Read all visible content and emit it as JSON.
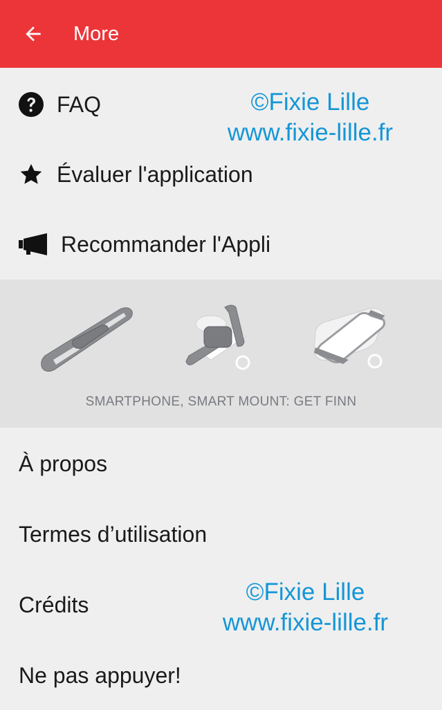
{
  "appbar": {
    "title": "More",
    "back_icon": "arrow-left-icon",
    "color": "#ec3539"
  },
  "menu_top": [
    {
      "label": "FAQ",
      "icon": "question-circle-icon"
    },
    {
      "label": "Évaluer l'application",
      "icon": "star-icon"
    },
    {
      "label": "Recommander l'Appli",
      "icon": "megaphone-icon"
    }
  ],
  "banner": {
    "caption": "SMARTPHONE, SMART MOUNT: GET FINN",
    "images": [
      "finn-strap-flat",
      "finn-strap-on-bar",
      "finn-phone-mounted"
    ]
  },
  "menu_bottom": [
    {
      "label": "À propos"
    },
    {
      "label": "Termes d’utilisation"
    },
    {
      "label": "Crédits"
    },
    {
      "label": "Ne pas appuyer!"
    }
  ],
  "watermarks": [
    {
      "line1": "©Fixie Lille",
      "line2": "www.fixie-lille.fr"
    },
    {
      "line1": "©Fixie Lille",
      "line2": "www.fixie-lille.fr"
    }
  ],
  "colors": {
    "background": "#efefef",
    "banner_bg": "#e1e1e1",
    "watermark": "#1596d6"
  }
}
